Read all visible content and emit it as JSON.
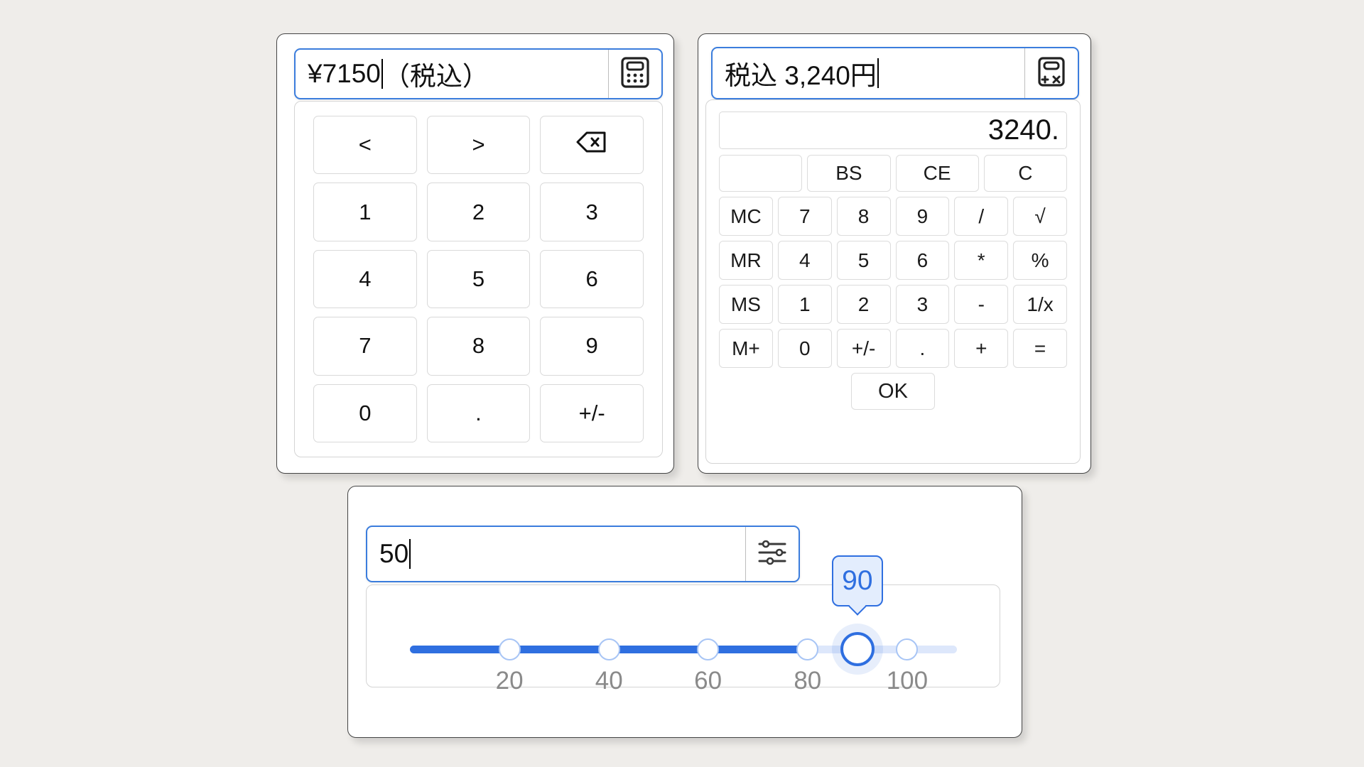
{
  "background_color": "#efedea",
  "accent_color": "#2f6fe0",
  "keypad_panel": {
    "input": {
      "value": "¥7150",
      "value_after_caret": "（税込）",
      "icon": "calculator-icon"
    },
    "keys": [
      "<",
      ">",
      "backspace-icon",
      "1",
      "2",
      "3",
      "4",
      "5",
      "6",
      "7",
      "8",
      "9",
      "0",
      ".",
      "+/-"
    ]
  },
  "calculator_panel": {
    "input": {
      "value": "税込 3,240円",
      "icon": "calculator-plus-times-icon"
    },
    "display_value": "3240.",
    "row_top": [
      "",
      "BS",
      "CE",
      "C"
    ],
    "rows": [
      [
        "MC",
        "7",
        "8",
        "9",
        "/",
        "√"
      ],
      [
        "MR",
        "4",
        "5",
        "6",
        "*",
        "%"
      ],
      [
        "MS",
        "1",
        "2",
        "3",
        "-",
        "1/x"
      ],
      [
        "M+",
        "0",
        "+/-",
        ".",
        "+",
        "="
      ]
    ],
    "ok_label": "OK"
  },
  "slider_panel": {
    "input": {
      "value": "50",
      "icon": "sliders-icon"
    },
    "tooltip_value": "90",
    "handle_value": 90,
    "min": 0,
    "max": 110,
    "ticks": [
      {
        "label": "20",
        "value": 20
      },
      {
        "label": "40",
        "value": 40
      },
      {
        "label": "60",
        "value": 60
      },
      {
        "label": "80",
        "value": 80
      },
      {
        "label": "100",
        "value": 100
      }
    ]
  }
}
